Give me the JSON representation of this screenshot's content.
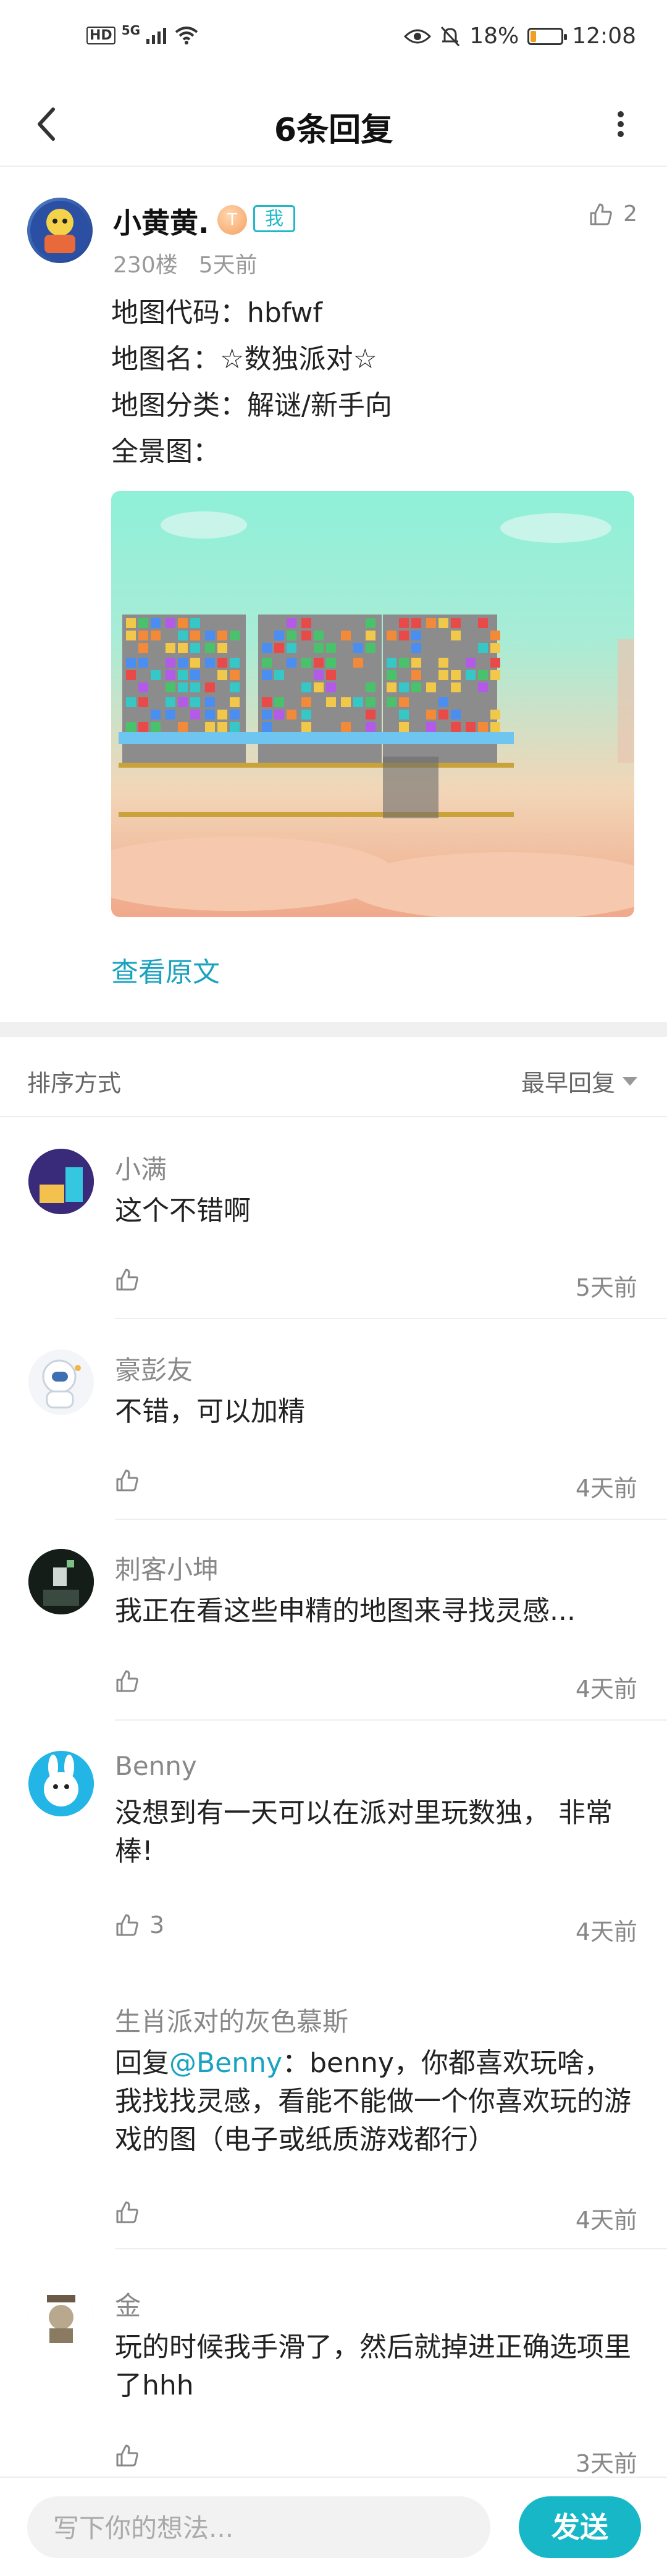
{
  "status_bar": {
    "left_icons": [
      "HD",
      "5G",
      "signal-bars",
      "wifi"
    ],
    "battery_percent_text": "18%",
    "battery_level": 0.18,
    "time": "12:08"
  },
  "nav": {
    "title": "6条回复",
    "back_icon": "chevron-left-icon",
    "more_icon": "more-vertical-icon"
  },
  "post": {
    "author": "小黄黄.",
    "level_badge": "T",
    "me_badge": "我",
    "like_count": "2",
    "floor": "230楼",
    "time": "5天前",
    "lines": [
      "地图代码：hbfwf",
      "地图名：☆数独派对☆",
      "地图分类：解谜/新手向",
      "全景图："
    ],
    "image_alt": "map panorama screenshot",
    "view_original": "查看原文"
  },
  "sort": {
    "label": "排序方式",
    "value": "最早回复"
  },
  "replies": [
    {
      "name": "小满",
      "text": "这个不错啊",
      "likes": "",
      "time": "5天前",
      "avatar_color": "#4a2f8f"
    },
    {
      "name": "豪彭友",
      "text": "不错，可以加精",
      "likes": "",
      "time": "4天前",
      "avatar_color": "#e8eef5"
    },
    {
      "name": "刺客小坤",
      "text": "我正在看这些申精的地图来寻找灵感...",
      "likes": "",
      "time": "4天前",
      "avatar_color": "#1d2a22"
    },
    {
      "name": "Benny",
      "text": "没想到有一天可以在派对里玩数独， 非常棒!",
      "likes": "3",
      "time": "4天前",
      "avatar_color": "#1fb7e8"
    },
    {
      "name": "生肖派对的灰色慕斯",
      "reply_prefix": "回复",
      "reply_at": "@Benny",
      "text": "：benny，你都喜欢玩啥，我找找灵感，看能不能做一个你喜欢玩的游戏的图（电子或纸质游戏都行）",
      "likes": "",
      "time": "4天前"
    },
    {
      "name": "金",
      "text": "玩的时候我手滑了，然后就掉进正确选项里了hhh",
      "likes": "",
      "time": "3天前",
      "avatar_color": "#d9d2c4"
    }
  ],
  "composer": {
    "placeholder": "写下你的想法...",
    "send_label": "发送"
  },
  "colors": {
    "accent": "#17b7c8",
    "link": "#1aa3c0"
  }
}
